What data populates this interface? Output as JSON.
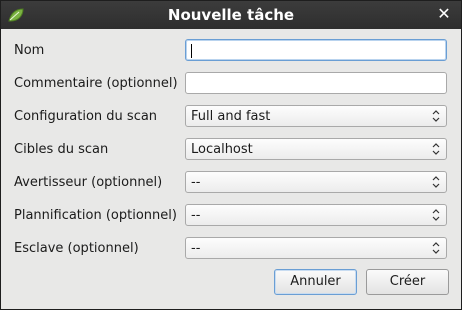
{
  "window": {
    "title": "Nouvelle tâche"
  },
  "form": {
    "name": {
      "label": "Nom",
      "value": ""
    },
    "comment": {
      "label": "Commentaire (optionnel)",
      "value": ""
    },
    "scan_config": {
      "label": "Configuration du scan",
      "value": "Full and fast"
    },
    "scan_targets": {
      "label": "Cibles du scan",
      "value": "Localhost"
    },
    "alert": {
      "label": "Avertisseur (optionnel)",
      "value": "--"
    },
    "schedule": {
      "label": "Plannification (optionnel)",
      "value": "--"
    },
    "slave": {
      "label": "Esclave (optionnel)",
      "value": "--"
    }
  },
  "buttons": {
    "cancel": "Annuler",
    "create": "Créer"
  },
  "colors": {
    "titlebar": "#2e2e2e",
    "focus": "#6a9ed4"
  }
}
